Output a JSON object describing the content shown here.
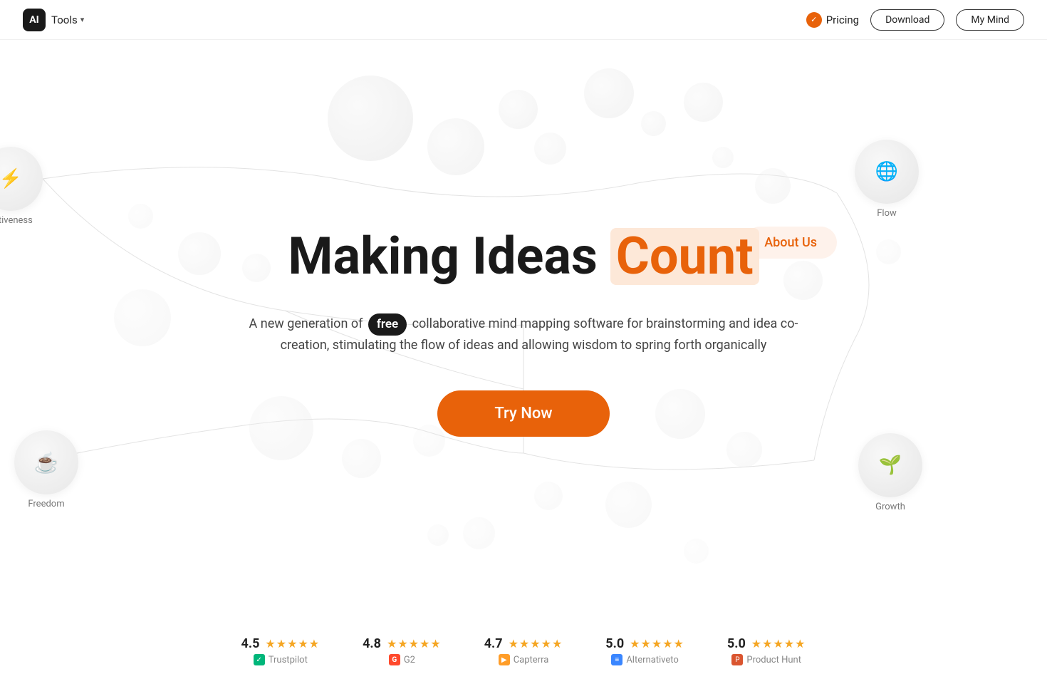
{
  "nav": {
    "logo_text": "AI",
    "tools_label": "Tools",
    "pricing_label": "Pricing",
    "download_label": "Download",
    "mymind_label": "My Mind"
  },
  "hero": {
    "title_part1": "Making Ideas ",
    "title_orange": "Count",
    "subtitle_before_free": "A new generation of ",
    "free_badge": "free",
    "subtitle_after_free": " collaborative mind mapping software for brainstorming and idea co-creation, stimulating the flow of ideas and allowing wisdom to spring forth organically",
    "cta_label": "Try Now",
    "about_us_label": "About Us",
    "flow_label": "Flow",
    "freedom_label": "Freedom",
    "effectiveness_label": "ectiveness",
    "growth_label": "Growth"
  },
  "ratings": [
    {
      "score": "4.5",
      "stars": "★★★★★",
      "source": "Trustpilot",
      "source_icon": "✓",
      "icon_class": "trustpilot-icon"
    },
    {
      "score": "4.8",
      "stars": "★★★★★",
      "source": "G2",
      "source_icon": "G",
      "icon_class": "g2-icon"
    },
    {
      "score": "4.7",
      "stars": "★★★★★",
      "source": "Capterra",
      "source_icon": "▶",
      "icon_class": "capterra-icon"
    },
    {
      "score": "5.0",
      "stars": "★★★★★",
      "source": "Alternativeto",
      "source_icon": "≡",
      "icon_class": "alternativeto-icon"
    },
    {
      "score": "5.0",
      "stars": "★★★★★",
      "source": "Product Hunt",
      "source_icon": "P",
      "icon_class": "producthunt-icon"
    }
  ],
  "colors": {
    "orange": "#e8620a",
    "dark": "#1a1a1a",
    "light_orange_bg": "#fef2eb"
  }
}
